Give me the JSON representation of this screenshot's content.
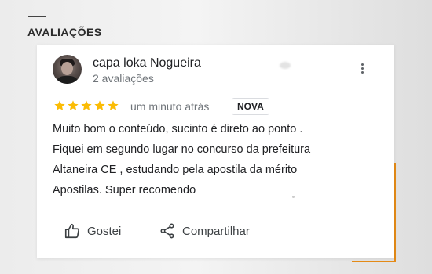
{
  "section": {
    "title": "AVALIAÇÕES"
  },
  "review": {
    "author": "capa loka Nogueira",
    "author_reviews": "2 avaliações",
    "rating": 5,
    "rating_max": 5,
    "time": "um minuto atrás",
    "badge": "NOVA",
    "text_lines": [
      "Muito bom o conteúdo, sucinto é direto ao ponto .",
      "Fiquei em segundo lugar no concurso da prefeitura",
      "Altaneira CE , estudando pela apostila da mérito",
      "Apostilas. Super recomendo"
    ]
  },
  "actions": {
    "like_label": "Gostei",
    "share_label": "Compartilhar"
  },
  "colors": {
    "star": "#fbbc04",
    "accent": "#e58a16",
    "text": "#202124",
    "muted": "#70757a"
  },
  "icons": {
    "more": "more-vert-icon",
    "like": "thumb-up-icon",
    "share": "share-icon"
  }
}
